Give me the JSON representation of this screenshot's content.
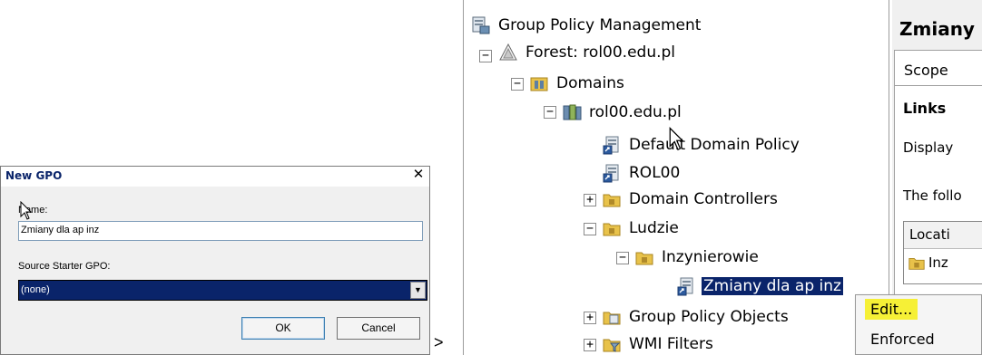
{
  "dialog": {
    "title": "New GPO",
    "close_glyph": "✕",
    "name_label": "Name:",
    "name_value": "Zmiany dla ap inz",
    "starter_label": "Source Starter GPO:",
    "starter_value": "(none)",
    "dropdown_arrow": "▼",
    "ok_label": "OK",
    "cancel_label": "Cancel"
  },
  "separator": ">",
  "tree": {
    "items": [
      {
        "label": "Group Policy Management",
        "icon": "gpmc-icon"
      },
      {
        "label": "Forest: rol00.edu.pl",
        "icon": "forest-icon",
        "expander": "−"
      },
      {
        "label": "Domains",
        "icon": "domains-icon",
        "expander": "−"
      },
      {
        "label": "rol00.edu.pl",
        "icon": "domain-icon",
        "expander": "−"
      },
      {
        "label": "Default Domain Policy",
        "icon": "gpo-link-icon"
      },
      {
        "label": "ROL00",
        "icon": "gpo-link-icon"
      },
      {
        "label": "Domain Controllers",
        "icon": "ou-folder-icon",
        "expander": "+"
      },
      {
        "label": "Ludzie",
        "icon": "ou-folder-icon",
        "expander": "−"
      },
      {
        "label": "Inzynierowie",
        "icon": "ou-folder-icon",
        "expander": "−"
      },
      {
        "label": "Zmiany dla ap inz",
        "icon": "gpo-link-icon"
      },
      {
        "label": "Group Policy Objects",
        "icon": "gpo-container-icon",
        "expander": "+"
      },
      {
        "label": "WMI Filters",
        "icon": "wmi-filter-icon",
        "expander": "+"
      }
    ]
  },
  "right_pane": {
    "title": "Zmiany",
    "tab": "Scope",
    "links_heading": "Links",
    "display_text": "Display",
    "following_text": "The follo",
    "table_header": "Locati",
    "row_text": "Inz"
  },
  "context_menu": {
    "items": [
      {
        "label": "Edit...",
        "highlighted": true
      },
      {
        "label": "Enforced",
        "highlighted": false
      }
    ],
    "highlight_color": "#f6f036"
  },
  "colors": {
    "selection": "#0a246a",
    "folder": "#e8c24a"
  }
}
